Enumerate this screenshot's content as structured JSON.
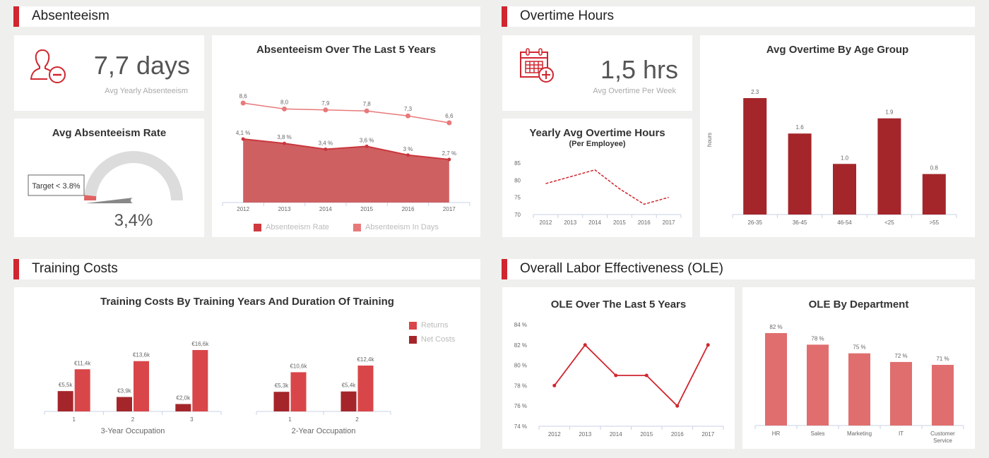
{
  "colors": {
    "accent": "#d0262f",
    "dark_red": "#a4262a",
    "medium_red": "#d94649",
    "area_red": "#cf6062",
    "light_red": "#e8797a",
    "ole_bar": "#e06e6e",
    "gauge_track": "#dcdcdc",
    "gauge_needle": "#888888",
    "background": "#efefee"
  },
  "sections": {
    "absenteeism": "Absenteeism",
    "overtime": "Overtime Hours",
    "training": "Training Costs",
    "ole": "Overall Labor Effectiveness (OLE)"
  },
  "kpis": {
    "absenteeism": {
      "icon": "user-minus-icon",
      "value": "7,7 days",
      "label": "Avg Yearly Absenteeism"
    },
    "overtime": {
      "icon": "calendar-plus-icon",
      "value": "1,5 hrs",
      "label": "Avg Overtime Per Week"
    }
  },
  "gauge": {
    "title": "Avg Absenteeism Rate",
    "target_label": "Target < 3.8%",
    "value_label": "3,4%",
    "value": 3.4,
    "target": 3.8
  },
  "chart_data": [
    {
      "id": "absenteeism_5y",
      "type": "area",
      "title": "Absenteeism Over The Last 5 Years",
      "categories": [
        "2012",
        "2013",
        "2014",
        "2015",
        "2016",
        "2017"
      ],
      "series": [
        {
          "name": "Absenteeism Rate",
          "values": [
            4.1,
            3.8,
            3.4,
            3.6,
            3.0,
            2.7
          ],
          "labels": [
            "4,1 %",
            "3,8 %",
            "3,4 %",
            "3,6 %",
            "3 %",
            "2,7 %"
          ],
          "kind": "area"
        },
        {
          "name": "Absenteeism In Days",
          "values": [
            8.6,
            8.0,
            7.9,
            7.8,
            7.3,
            6.6
          ],
          "labels": [
            "8,6",
            "8,0",
            "7,9",
            "7,8",
            "7,3",
            "6,6"
          ],
          "kind": "line"
        }
      ],
      "legend": "bottom"
    },
    {
      "id": "yearly_overtime",
      "type": "line",
      "title": "Yearly Avg Overtime Hours",
      "subtitle": "(Per Employee)",
      "categories": [
        "2012",
        "2013",
        "2014",
        "2015",
        "2016",
        "2017"
      ],
      "values": [
        79,
        81,
        83,
        77.5,
        73,
        75
      ],
      "yticks": [
        "70",
        "75",
        "80",
        "85"
      ],
      "ylim": [
        70,
        85
      ],
      "style": "dashed"
    },
    {
      "id": "overtime_age",
      "type": "bar",
      "title": "Avg Overtime By Age Group",
      "ylabel": "hours",
      "categories": [
        "26-35",
        "36-45",
        "46-54",
        "<25",
        ">55"
      ],
      "values": [
        2.3,
        1.6,
        1.0,
        1.9,
        0.8
      ],
      "labels": [
        "2.3",
        "1.6",
        "1.0",
        "1.9",
        "0.8"
      ],
      "ylim": [
        0,
        2.3
      ]
    },
    {
      "id": "training_costs",
      "type": "bar",
      "title": "Training Costs By Training Years And Duration Of Training",
      "legend": "top-right",
      "series_names": [
        "Returns",
        "Net Costs"
      ],
      "groups": [
        {
          "name": "3-Year Occupation",
          "categories": [
            "1",
            "2",
            "3"
          ],
          "net_costs": [
            5.5,
            3.9,
            2.0
          ],
          "net_labels": [
            "€5,5k",
            "€3,9k",
            "€2,0k"
          ],
          "returns": [
            11.4,
            13.6,
            16.6
          ],
          "return_labels": [
            "€11,4k",
            "€13,6k",
            "€16,6k"
          ]
        },
        {
          "name": "2-Year Occupation",
          "categories": [
            "1",
            "2"
          ],
          "net_costs": [
            5.3,
            5.4
          ],
          "net_labels": [
            "€5,3k",
            "€5,4k"
          ],
          "returns": [
            10.6,
            12.4
          ],
          "return_labels": [
            "€10,6k",
            "€12,4k"
          ]
        }
      ],
      "ylim": [
        0,
        16.6
      ]
    },
    {
      "id": "ole_5y",
      "type": "line",
      "title": "OLE Over The Last 5 Years",
      "categories": [
        "2012",
        "2013",
        "2014",
        "2015",
        "2016",
        "2017"
      ],
      "values": [
        78,
        82,
        79,
        79,
        76,
        82
      ],
      "yticks": [
        "74 %",
        "76 %",
        "78 %",
        "80 %",
        "82 %",
        "84 %"
      ],
      "ylim": [
        74,
        84
      ]
    },
    {
      "id": "ole_department",
      "type": "bar",
      "title": "OLE By Department",
      "categories": [
        "HR",
        "Sales",
        "Marketing",
        "IT",
        "Customer Service"
      ],
      "values": [
        82,
        78,
        75,
        72,
        71
      ],
      "labels": [
        "82 %",
        "78 %",
        "75 %",
        "72 %",
        "71 %"
      ],
      "ylim": [
        60,
        82
      ]
    }
  ]
}
